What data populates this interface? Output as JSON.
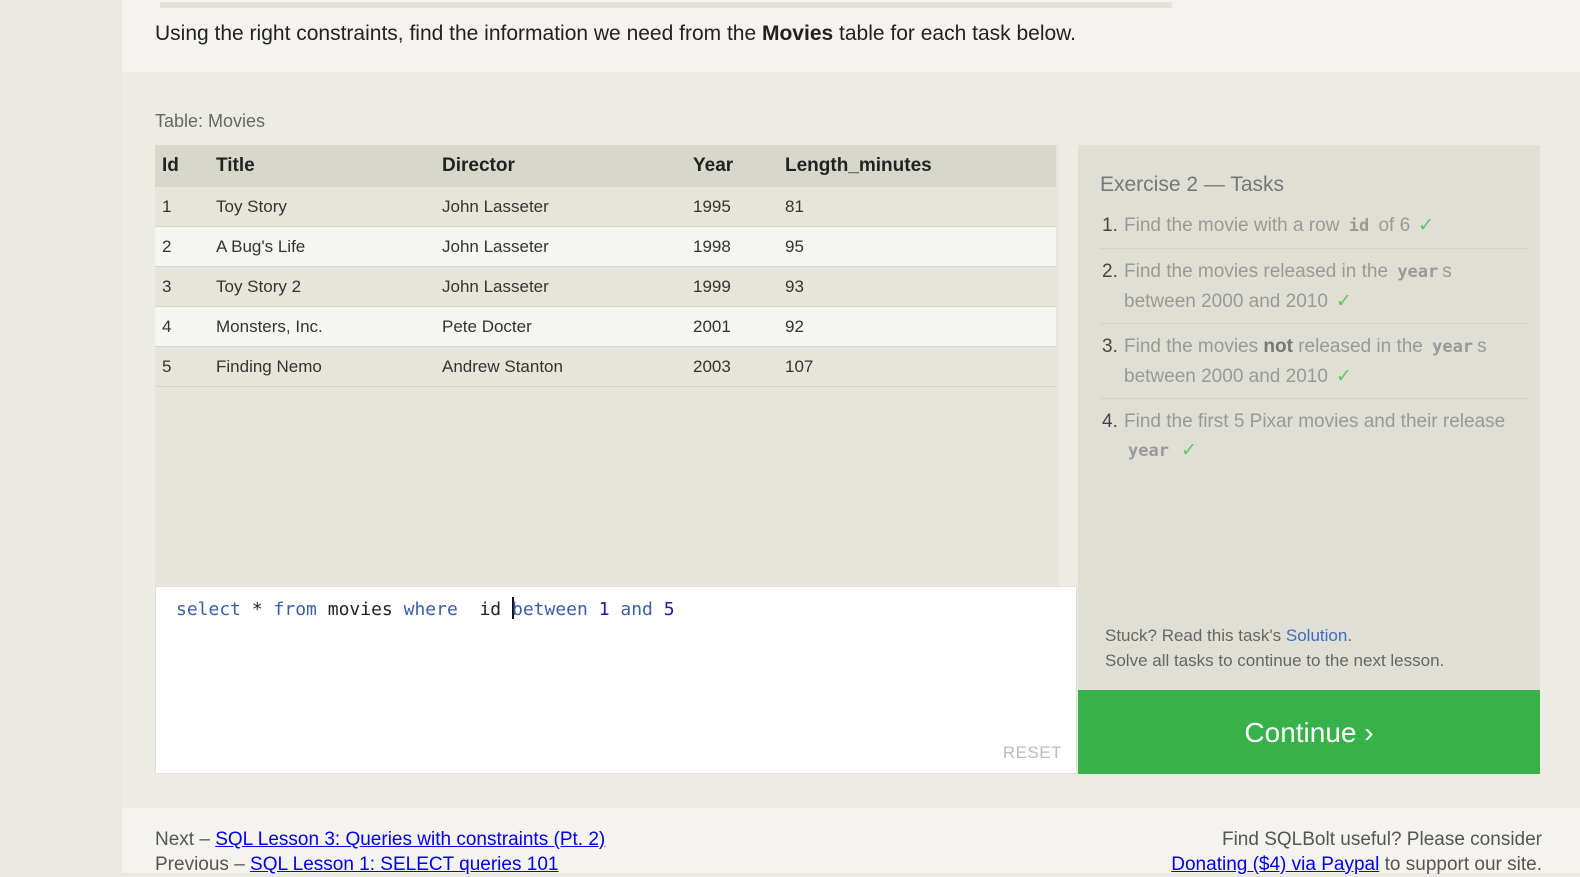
{
  "intro": {
    "before": "Using the right constraints, find the information we need from the ",
    "bold": "Movies",
    "after": " table for each task below."
  },
  "table": {
    "caption": "Table: Movies",
    "columns": [
      "Id",
      "Title",
      "Director",
      "Year",
      "Length_minutes"
    ],
    "rows": [
      [
        "1",
        "Toy Story",
        "John Lasseter",
        "1995",
        "81"
      ],
      [
        "2",
        "A Bug's Life",
        "John Lasseter",
        "1998",
        "95"
      ],
      [
        "3",
        "Toy Story 2",
        "John Lasseter",
        "1999",
        "93"
      ],
      [
        "4",
        "Monsters, Inc.",
        "Pete Docter",
        "2001",
        "92"
      ],
      [
        "5",
        "Finding Nemo",
        "Andrew Stanton",
        "2003",
        "107"
      ]
    ]
  },
  "editor": {
    "tokens": [
      "select",
      " * ",
      "from",
      " movies ",
      "where",
      "  id ",
      "between",
      " ",
      "1",
      " ",
      "and",
      " ",
      "5"
    ],
    "reset_label": "RESET"
  },
  "tasks": {
    "title": "Exercise 2 — Tasks",
    "items": [
      {
        "num": "1.",
        "parts": [
          "Find the movie with a row ",
          "id",
          " of 6"
        ]
      },
      {
        "num": "2.",
        "parts": [
          "Find the movies released in the ",
          "year",
          "s between 2000 and 2010"
        ]
      },
      {
        "num": "3.",
        "parts": [
          "Find the movies ",
          "not",
          " released in the ",
          "year",
          "s between 2000 and 2010"
        ]
      },
      {
        "num": "4.",
        "parts": [
          "Find the first 5 Pixar movies and their release ",
          "year"
        ]
      }
    ],
    "check_symbol": "✓",
    "stuck_prefix": "Stuck? Read this task's ",
    "solution_link": "Solution",
    "stuck_suffix": ".",
    "solve_all": "Solve all tasks to continue to the next lesson."
  },
  "continue_label": "Continue ›",
  "footer": {
    "next_prefix": "Next – ",
    "next_link": "SQL Lesson 3: Queries with constraints (Pt. 2)",
    "prev_prefix": "Previous – ",
    "prev_link": "SQL Lesson 1: SELECT queries 101",
    "support_text": "Find SQLBolt useful? Please consider",
    "donate_link": "Donating ($4) via Paypal",
    "support_suffix": " to support our site."
  },
  "colors": {
    "accent_green": "#37b24a",
    "link_blue": "#3b6cc6",
    "check_green": "#62c462"
  }
}
